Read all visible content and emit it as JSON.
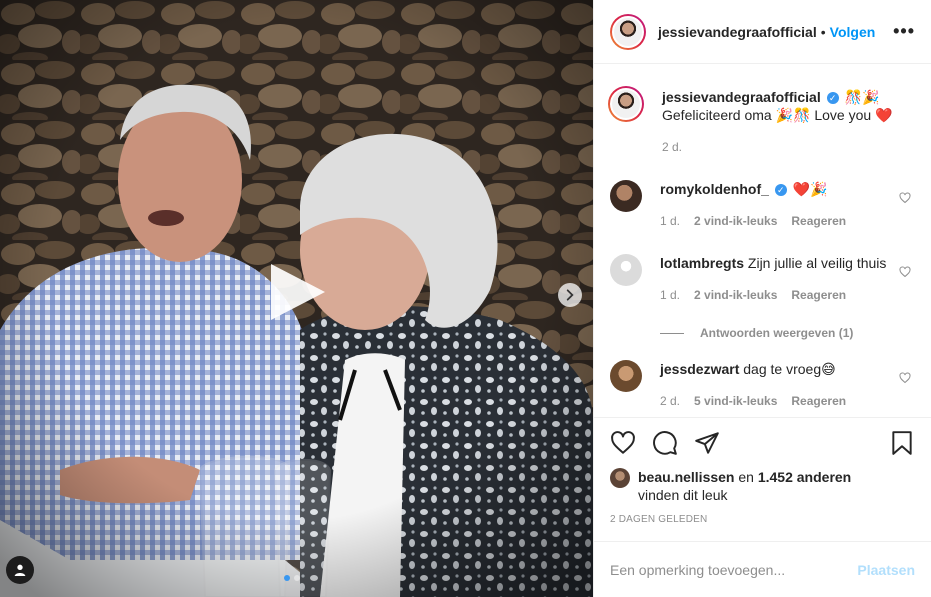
{
  "post": {
    "author": "jessievandegraafofficial",
    "follow_label": "Volgen",
    "more_label": "•••",
    "separator": "•"
  },
  "caption": {
    "username": "jessievandegraafofficial",
    "emoji_after_name": "🎊🎉",
    "text": "Gefeliciteerd oma 🎉🎊 Love you",
    "heart": "❤️",
    "time": "2 d."
  },
  "comments": [
    {
      "username": "romykoldenhof_",
      "text": "❤️🎉",
      "time": "1 d.",
      "likes": "2 vind-ik-leuks",
      "reply": "Reageren"
    },
    {
      "username": "lotlambregts",
      "text": "Zijn jullie al veilig thuis",
      "time": "1 d.",
      "likes": "2 vind-ik-leuks",
      "reply": "Reageren",
      "view_replies": "Antwoorden weergeven (1)"
    },
    {
      "username": "jessdezwart",
      "text": "dag te vroeg😅",
      "time": "2 d.",
      "likes": "5 vind-ik-leuks",
      "reply": "Reageren"
    }
  ],
  "likes": {
    "user": "beau.nellissen",
    "connector": " en ",
    "count": "1.452 anderen",
    "suffix": "vinden dit leuk"
  },
  "timestamp": "2 DAGEN GELEDEN",
  "add_comment": {
    "placeholder": "Een opmerking toevoegen...",
    "post_label": "Plaatsen"
  },
  "colors": {
    "link_blue": "#0095f6",
    "disabled_blue": "#b2dffc",
    "heart_red": "#ed4956",
    "muted_gray": "#8e8e8e"
  },
  "icons": {
    "media": [
      "play-icon",
      "chevron-right-icon",
      "user-tag-icon"
    ],
    "actions": [
      "heart-icon",
      "comment-icon",
      "share-icon",
      "bookmark-icon"
    ]
  },
  "carousel": {
    "slides": 2,
    "active": 1
  }
}
